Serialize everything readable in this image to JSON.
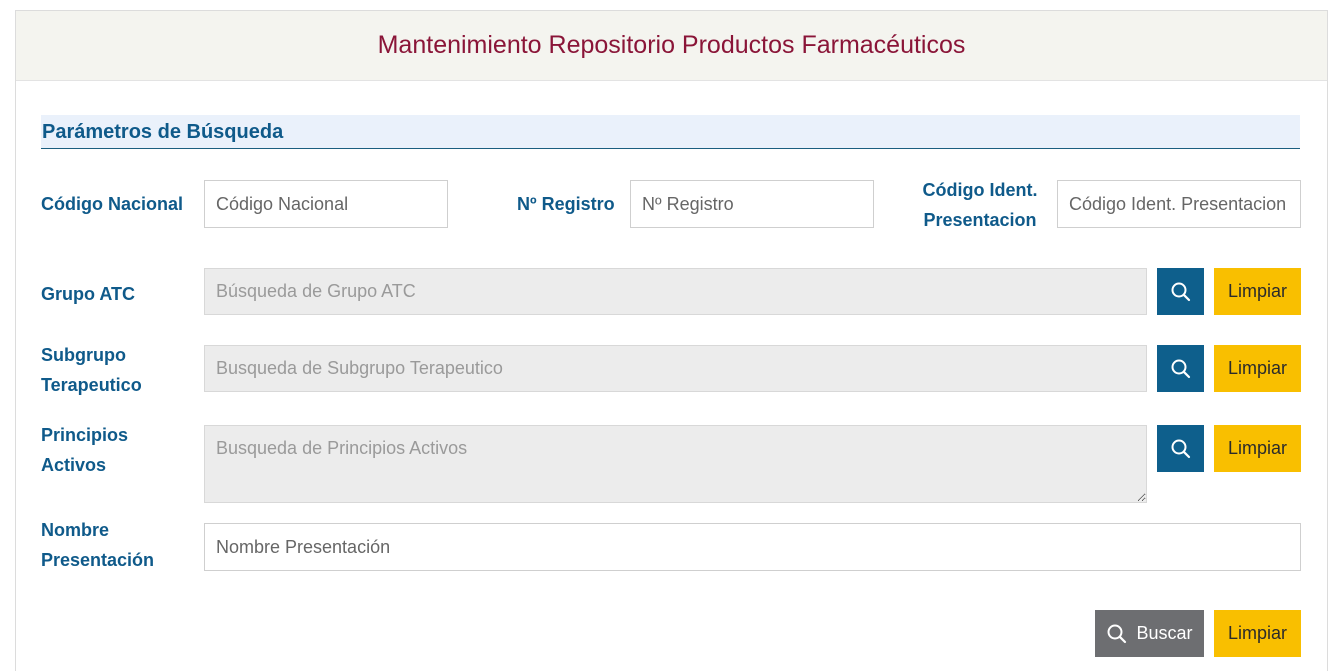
{
  "header": {
    "title": "Mantenimiento Repositorio Productos Farmacéuticos"
  },
  "section": {
    "title": "Parámetros de Búsqueda"
  },
  "fields": {
    "codigo_nacional": {
      "label": "Código Nacional",
      "placeholder": "Código Nacional",
      "value": ""
    },
    "n_registro": {
      "label": "Nº Registro",
      "placeholder": "Nº Registro",
      "value": ""
    },
    "codigo_ident": {
      "label_line1": "Código Ident.",
      "label_line2": "Presentacion",
      "placeholder": "Código Ident. Presentacion",
      "value": ""
    },
    "grupo_atc": {
      "label": "Grupo ATC",
      "placeholder": "Búsqueda de Grupo ATC",
      "value": "",
      "clear_label": "Limpiar"
    },
    "subgrupo": {
      "label_line1": "Subgrupo",
      "label_line2": "Terapeutico",
      "placeholder": "Busqueda de Subgrupo Terapeutico",
      "value": "",
      "clear_label": "Limpiar"
    },
    "principios": {
      "label_line1": "Principios",
      "label_line2": "Activos",
      "placeholder": "Busqueda de Principios Activos",
      "value": "",
      "clear_label": "Limpiar"
    },
    "nombre": {
      "label_line1": "Nombre",
      "label_line2": "Presentación",
      "placeholder": "Nombre Presentación",
      "value": ""
    }
  },
  "actions": {
    "search_label": "Buscar",
    "clear_label": "Limpiar"
  },
  "icons": {
    "search": "search-icon"
  },
  "colors": {
    "title": "#8a1538",
    "label": "#0f5a8a",
    "search_button": "#0e5f8c",
    "clear_button": "#f9bf00",
    "buscar_button": "#6d6e71"
  }
}
